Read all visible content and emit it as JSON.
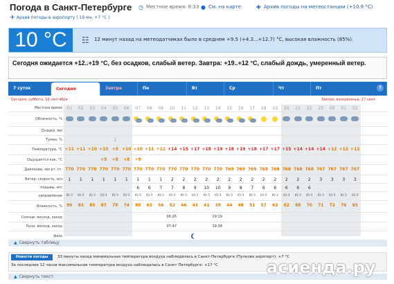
{
  "header": {
    "title": "Погода в Санкт-Петербурге",
    "local_time": "Местное время: 8:33",
    "map_link": "См. на карте",
    "archive_station_link": "Архив погоды на метеостанции (+10.9 °C)",
    "airport_archive_link": "Архив погоды в аэропорту ( 19 мн, +7 °C )"
  },
  "current": {
    "temperature": "10 °C",
    "icon": "weather-station-icon",
    "description": "12 минут назад на метеодатчиках было в среднем +9.5 (+4.3...+12.7) °C, высокая влажность (85%)."
  },
  "forecast_text": "Сегодня ожидается +12..+19 °C, без осадков, слабый ветер. Завтра: +19..+12 °C, слабый дождь, умеренный ветер.",
  "tabs": [
    {
      "label": "7 суток",
      "active": false,
      "weekend": false
    },
    {
      "label": "Сегодня",
      "active": true,
      "weekend": false
    },
    {
      "label": "Завтра",
      "active": false,
      "weekend": true
    },
    {
      "label": "Пн",
      "active": false,
      "weekend": false
    },
    {
      "label": "Вт",
      "active": false,
      "weekend": false
    },
    {
      "label": "Ср",
      "active": false,
      "weekend": false
    },
    {
      "label": "Чт",
      "active": false,
      "weekend": false
    },
    {
      "label": "Пт",
      "active": false,
      "weekend": false
    }
  ],
  "help_icon": "?",
  "day_labels": {
    "today": "Сегодня, суббота, 16 сентября",
    "tomorrow": "Завтра, воскресенье, 17 сент"
  },
  "row_labels": {
    "time": "Местное время",
    "clouds": "Облачность, %",
    "precip": "Осадки, мм",
    "fog": "Туман, %",
    "temp": "Температура, °С",
    "feels": "Ощущается как, °С",
    "pressure": "Давление, мм рт. ст.",
    "wind_speed": "Ветер: скорость, м/с",
    "gusts": "порывы, м/с",
    "direction": "направление",
    "humidity": "Влажность, %",
    "sun": "Солнце: восход, заход",
    "moon": "Луна: восход, заход",
    "phase": "фаза"
  },
  "hours": [
    "01",
    "02",
    "03",
    "04",
    "05",
    "06",
    "07",
    "08",
    "09",
    "10",
    "11",
    "12",
    "13",
    "14",
    "15",
    "16",
    "17",
    "18",
    "19",
    "20",
    "21",
    "22",
    "23",
    "00",
    "01",
    "02"
  ],
  "clouds_icons": [
    "cloud",
    "cloud",
    "cloud",
    "cloud",
    "cloud",
    "cloud",
    "pc",
    "pc",
    "pc",
    "pc",
    "pc",
    "pc",
    "pc",
    "pc",
    "pc",
    "pc",
    "pc",
    "sun",
    "sun",
    "cloud",
    "cloud",
    "cloud",
    "cloud",
    "cloud",
    "cloud",
    "cloud"
  ],
  "fog": {
    "index": 4,
    "value": "1"
  },
  "temps": [
    "+11",
    "+11",
    "+10",
    "+10",
    "+9",
    "+10",
    "+10",
    "+11",
    "+12",
    "+14",
    "+15",
    "+17",
    "+18",
    "+19",
    "+18",
    "+19",
    "+18",
    "+17",
    "+17",
    "+15",
    "+14",
    "+14",
    "+14",
    "+12",
    "+12",
    "+12"
  ],
  "feels": {
    "start": 3,
    "values": [
      "+9",
      "+8",
      "+8",
      "+9"
    ]
  },
  "pressure": [
    "770",
    "770",
    "770",
    "770",
    "770",
    "770",
    "770",
    "770",
    "770",
    "770",
    "770",
    "770",
    "770",
    "770",
    "769",
    "769",
    "769",
    "768",
    "768",
    "768",
    "768",
    "768",
    "767",
    "767",
    "767",
    "767"
  ],
  "wind": [
    "1",
    "1",
    "1",
    "1",
    "1",
    "1",
    "1",
    "1",
    "1",
    "2",
    "2",
    "2",
    "2",
    "2",
    "2",
    "2",
    "2",
    "2",
    "2",
    "2",
    "2",
    "2",
    "3",
    "3",
    "3",
    "3"
  ],
  "gusts": {
    "start": 6,
    "values": [
      "6",
      "6",
      "7",
      "7",
      "8",
      "9",
      "10",
      "10",
      "9",
      "8",
      "7",
      "6",
      "6",
      "6",
      "6",
      "6"
    ]
  },
  "directions": [
    "Ю-З",
    "Ю-З",
    "Ю-З",
    "Ю-З",
    "Ю-З",
    "Ю-З",
    "Ю-З",
    "Ю-З",
    "Ю-З",
    "Ю-З",
    "Ю-З",
    "Ю-З",
    "Ю-З",
    "Ю-З",
    "Ю-З",
    "Ю-З",
    "Ю-З",
    "Ю-З",
    "Ю-З",
    "Ю-З",
    "Ю-З",
    "Ю-З",
    "Ю-З",
    "Ю-З",
    "Ю-З",
    "Ю-З"
  ],
  "humidity": [
    "90",
    "83",
    "85",
    "87",
    "78",
    "74",
    "80",
    "63",
    "56",
    "52",
    "46",
    "43",
    "41",
    "39",
    "44",
    "48",
    "51",
    "57",
    "63",
    "62",
    "68",
    "70",
    "71",
    "72",
    "76",
    "65"
  ],
  "sun": {
    "rise": "06:26",
    "set": "19:19"
  },
  "moon": {
    "rise": "07:47",
    "set": "19:38"
  },
  "collapse_table": "Свернуть таблицу",
  "news": {
    "button": "Новости погоды",
    "line1": "33 минуты назад минимальная температура воздуха наблюдалась в Санкт-Петербурге (Пулково аэропорт): +7 °C",
    "line2": "За последние 12 часов максимальная температура воздуха наблюдалась в Санкт Петербурге: +17 °C",
    "collapse_text": "Свернуть текст"
  },
  "watermark": "асиенда.ру",
  "colors": {
    "accent": "#1f6fc4",
    "temp_tile": "#1a7fd4",
    "warm": "#d82222"
  }
}
